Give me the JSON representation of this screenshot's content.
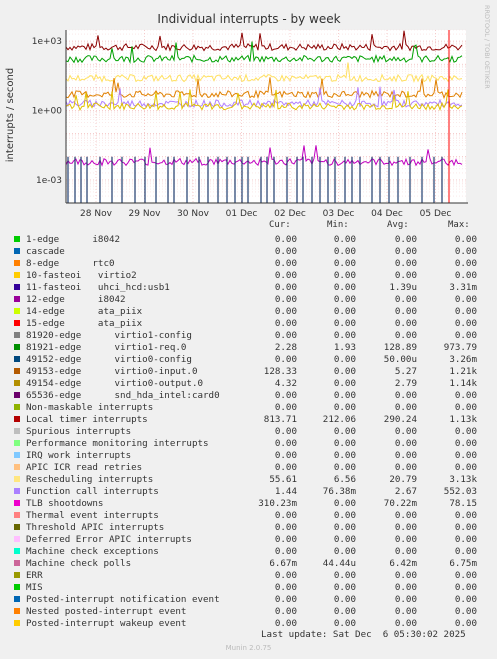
{
  "chart_data": {
    "type": "line",
    "title": "Individual interrupts - by week",
    "ylabel": "interrupts / second",
    "y_scale": "log",
    "ylim": [
      0.0001,
      3000
    ],
    "y_ticks": [
      {
        "value": 1000,
        "label": "1e+03"
      },
      {
        "value": 1,
        "label": "1e+00"
      },
      {
        "value": 0.001,
        "label": "1e-03"
      }
    ],
    "x_ticks": [
      "28 Nov",
      "29 Nov",
      "30 Nov",
      "01 Dec",
      "02 Dec",
      "03 Dec",
      "04 Dec",
      "05 Dec"
    ],
    "side_label": "RRDTOOL / TOBI OETIKER",
    "grid": true,
    "series": [
      {
        "name": "Local timer interrupts",
        "color": "#8c0000",
        "level": 550
      },
      {
        "name": "virtio1-req.0",
        "color": "#00a000",
        "level": 170
      },
      {
        "name": "Rescheduling interrupts",
        "color": "#ffe060",
        "level": 25
      },
      {
        "name": "virtio0-input.0",
        "color": "#e08000",
        "level": 5
      },
      {
        "name": "Function call interrupts",
        "color": "#b080ff",
        "level": 2
      },
      {
        "name": "virtio0-output.0",
        "color": "#e0c000",
        "level": 1.5
      },
      {
        "name": "Machine check polls",
        "color": "#c000c0",
        "level": 0.006
      },
      {
        "name": "TLB shootdowns",
        "color": "#1e3c6e",
        "level": 0.01
      }
    ],
    "current_marker_color": "#ff0000"
  },
  "legend": {
    "headers": {
      "cur": "Cur:",
      "min": "Min:",
      "avg": "Avg:",
      "max": "Max:"
    },
    "rows": [
      {
        "color": "#00cc00",
        "label": "1-edge      i8042",
        "cur": "0.00",
        "min": "0.00",
        "avg": "0.00",
        "max": "0.00"
      },
      {
        "color": "#0066b3",
        "label": "cascade",
        "cur": "0.00",
        "min": "0.00",
        "avg": "0.00",
        "max": "0.00"
      },
      {
        "color": "#ff8000",
        "label": "8-edge      rtc0",
        "cur": "0.00",
        "min": "0.00",
        "avg": "0.00",
        "max": "0.00"
      },
      {
        "color": "#ffcc00",
        "label": "10-fasteoi   virtio2",
        "cur": "0.00",
        "min": "0.00",
        "avg": "0.00",
        "max": "0.00"
      },
      {
        "color": "#330099",
        "label": "11-fasteoi   uhci_hcd:usb1",
        "cur": "0.00",
        "min": "0.00",
        "avg": "1.39u",
        "max": "3.31m"
      },
      {
        "color": "#990099",
        "label": "12-edge      i8042",
        "cur": "0.00",
        "min": "0.00",
        "avg": "0.00",
        "max": "0.00"
      },
      {
        "color": "#ccff00",
        "label": "14-edge      ata_piix",
        "cur": "0.00",
        "min": "0.00",
        "avg": "0.00",
        "max": "0.00"
      },
      {
        "color": "#ff0000",
        "label": "15-edge      ata_piix",
        "cur": "0.00",
        "min": "0.00",
        "avg": "0.00",
        "max": "0.00"
      },
      {
        "color": "#808080",
        "label": "81920-edge      virtio1-config",
        "cur": "0.00",
        "min": "0.00",
        "avg": "0.00",
        "max": "0.00"
      },
      {
        "color": "#008f00",
        "label": "81921-edge      virtio1-req.0",
        "cur": "2.28",
        "min": "1.93",
        "avg": "128.89",
        "max": "973.79"
      },
      {
        "color": "#00487d",
        "label": "49152-edge      virtio0-config",
        "cur": "0.00",
        "min": "0.00",
        "avg": "50.00u",
        "max": "3.26m"
      },
      {
        "color": "#b35a00",
        "label": "49153-edge      virtio0-input.0",
        "cur": "128.33",
        "min": "0.00",
        "avg": "5.27",
        "max": "1.21k"
      },
      {
        "color": "#b38f00",
        "label": "49154-edge      virtio0-output.0",
        "cur": "4.32",
        "min": "0.00",
        "avg": "2.79",
        "max": "1.14k"
      },
      {
        "color": "#6b006b",
        "label": "65536-edge      snd_hda_intel:card0",
        "cur": "0.00",
        "min": "0.00",
        "avg": "0.00",
        "max": "0.00"
      },
      {
        "color": "#8fb300",
        "label": "Non-maskable interrupts",
        "cur": "0.00",
        "min": "0.00",
        "avg": "0.00",
        "max": "0.00"
      },
      {
        "color": "#b30000",
        "label": "Local timer interrupts",
        "cur": "813.71",
        "min": "212.06",
        "avg": "290.24",
        "max": "1.13k"
      },
      {
        "color": "#bebebe",
        "label": "Spurious interrupts",
        "cur": "0.00",
        "min": "0.00",
        "avg": "0.00",
        "max": "0.00"
      },
      {
        "color": "#80ff80",
        "label": "Performance monitoring interrupts",
        "cur": "0.00",
        "min": "0.00",
        "avg": "0.00",
        "max": "0.00"
      },
      {
        "color": "#80c9ff",
        "label": "IRQ work interrupts",
        "cur": "0.00",
        "min": "0.00",
        "avg": "0.00",
        "max": "0.00"
      },
      {
        "color": "#ffc080",
        "label": "APIC ICR read retries",
        "cur": "0.00",
        "min": "0.00",
        "avg": "0.00",
        "max": "0.00"
      },
      {
        "color": "#ffe680",
        "label": "Rescheduling interrupts",
        "cur": "55.61",
        "min": "6.56",
        "avg": "20.79",
        "max": "3.13k"
      },
      {
        "color": "#aa80ff",
        "label": "Function call interrupts",
        "cur": "1.44",
        "min": "76.38m",
        "avg": "2.67",
        "max": "552.03"
      },
      {
        "color": "#ee00cc",
        "label": "TLB shootdowns",
        "cur": "310.23m",
        "min": "0.00",
        "avg": "70.22m",
        "max": "78.15"
      },
      {
        "color": "#ff8080",
        "label": "Thermal event interrupts",
        "cur": "0.00",
        "min": "0.00",
        "avg": "0.00",
        "max": "0.00"
      },
      {
        "color": "#666600",
        "label": "Threshold APIC interrupts",
        "cur": "0.00",
        "min": "0.00",
        "avg": "0.00",
        "max": "0.00"
      },
      {
        "color": "#ffbfff",
        "label": "Deferred Error APIC interrupts",
        "cur": "0.00",
        "min": "0.00",
        "avg": "0.00",
        "max": "0.00"
      },
      {
        "color": "#00ffcc",
        "label": "Machine check exceptions",
        "cur": "0.00",
        "min": "0.00",
        "avg": "0.00",
        "max": "0.00"
      },
      {
        "color": "#cc6699",
        "label": "Machine check polls",
        "cur": "6.67m",
        "min": "44.44u",
        "avg": "6.42m",
        "max": "6.75m"
      },
      {
        "color": "#999900",
        "label": "ERR",
        "cur": "0.00",
        "min": "0.00",
        "avg": "0.00",
        "max": "0.00"
      },
      {
        "color": "#00cc00",
        "label": "MIS",
        "cur": "0.00",
        "min": "0.00",
        "avg": "0.00",
        "max": "0.00"
      },
      {
        "color": "#0066b3",
        "label": "Posted-interrupt notification event",
        "cur": "0.00",
        "min": "0.00",
        "avg": "0.00",
        "max": "0.00"
      },
      {
        "color": "#ff8000",
        "label": "Nested posted-interrupt event",
        "cur": "0.00",
        "min": "0.00",
        "avg": "0.00",
        "max": "0.00"
      },
      {
        "color": "#ffcc00",
        "label": "Posted-interrupt wakeup event",
        "cur": "0.00",
        "min": "0.00",
        "avg": "0.00",
        "max": "0.00"
      }
    ]
  },
  "footer": {
    "last_update": "Last update: Sat Dec  6 05:30:02 2025",
    "munin": "Munin 2.0.75"
  }
}
